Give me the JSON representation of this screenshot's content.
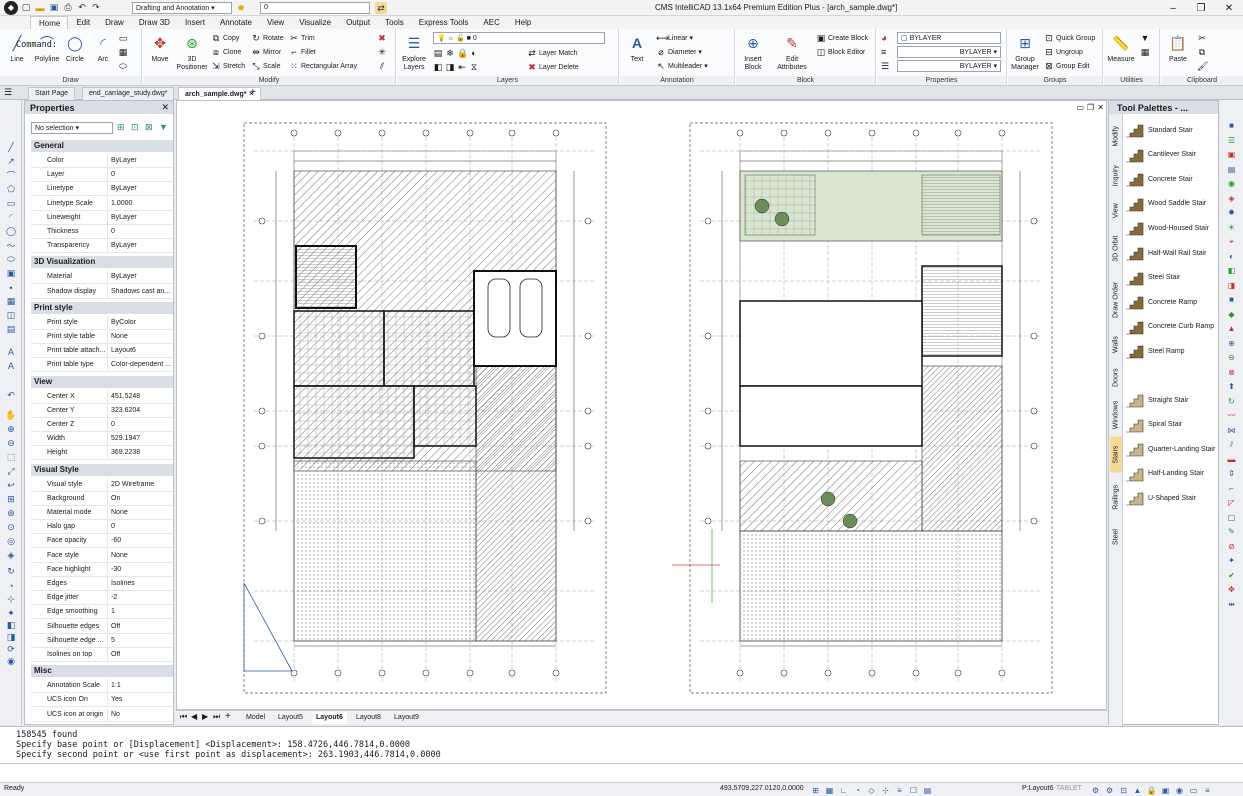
{
  "window": {
    "title": "CMS IntelliCAD 13.1x64 Premium Edition Plus - [arch_sample.dwg*]",
    "workspace": "Drafting and Annotation",
    "layer_combo": "0"
  },
  "menu": [
    "Home",
    "Edit",
    "Draw",
    "Draw 3D",
    "Insert",
    "Annotate",
    "View",
    "Visualize",
    "Output",
    "Tools",
    "Express Tools",
    "AEC",
    "Help"
  ],
  "ribbon": {
    "draw": {
      "label": "Draw",
      "line": "Line",
      "polyline": "Polyline",
      "circle": "Circle",
      "arc": "Arc"
    },
    "modify": {
      "label": "Modify",
      "move": "Move",
      "positioner": "3D Positioner",
      "copy": "Copy",
      "clone": "Clone",
      "stretch": "Stretch",
      "rotate": "Rotate",
      "mirror": "Mirror",
      "scale": "Scale",
      "trim": "Trim",
      "fillet": "Fillet",
      "rect_array": "Rectangular Array"
    },
    "layers": {
      "label": "Layers",
      "explore": "Explore Layers",
      "current": "0",
      "match": "Layer Match",
      "delete": "Layer Delete"
    },
    "annotation": {
      "label": "Annotation",
      "text": "Text",
      "linear": "Linear",
      "diameter": "Diameter",
      "multileader": "Multileader"
    },
    "block": {
      "label": "Block",
      "insert": "Insert Block",
      "edit_attr": "Edit Attributes",
      "create": "Create Block",
      "editor": "Block Editor"
    },
    "properties": {
      "label": "Properties",
      "layer": "BYLAYER",
      "linetype": "BYLAYER",
      "lineweight": "BYLAYER"
    },
    "groups": {
      "label": "Groups",
      "manager": "Group Manager",
      "quick": "Quick Group",
      "ungroup": "Ungroup",
      "edit": "Group Edit"
    },
    "utilities": {
      "label": "Utilities",
      "measure": "Measure"
    },
    "clipboard": {
      "label": "Clipboard",
      "paste": "Paste"
    }
  },
  "doc_tabs": [
    "Start Page",
    "end_carriage_study.dwg*",
    "arch_sample.dwg*"
  ],
  "properties_panel": {
    "title": "Properties",
    "selection": "No selection",
    "categories": [
      {
        "name": "General",
        "rows": [
          [
            "Color",
            "ByLayer"
          ],
          [
            "Layer",
            "0"
          ],
          [
            "Linetype",
            "ByLayer"
          ],
          [
            "Linetype Scale",
            "1.0000"
          ],
          [
            "Lineweight",
            "ByLayer"
          ],
          [
            "Thickness",
            "0"
          ],
          [
            "Transparency",
            "ByLayer"
          ]
        ]
      },
      {
        "name": "3D Visualization",
        "rows": [
          [
            "Material",
            "ByLayer"
          ],
          [
            "Shadow display",
            "Shadows cast an..."
          ]
        ]
      },
      {
        "name": "Print style",
        "rows": [
          [
            "Print style",
            "ByColor"
          ],
          [
            "Print style table",
            "None"
          ],
          [
            "Print table attach...",
            "Layout6"
          ],
          [
            "Print table type",
            "Color-dependent ..."
          ]
        ]
      },
      {
        "name": "View",
        "rows": [
          [
            "Center X",
            "451.5248"
          ],
          [
            "Center Y",
            "323.6204"
          ],
          [
            "Center Z",
            "0"
          ],
          [
            "Width",
            "529.1947"
          ],
          [
            "Height",
            "369.2238"
          ]
        ]
      },
      {
        "name": "Visual Style",
        "rows": [
          [
            "Visual style",
            "2D Wireframe"
          ],
          [
            "Background",
            "On"
          ],
          [
            "Material mode",
            "None"
          ],
          [
            "Halo gap",
            "0"
          ],
          [
            "Face opacity",
            "-60"
          ],
          [
            "Face style",
            "None"
          ],
          [
            "Face highlight",
            "-30"
          ],
          [
            "Edges",
            "Isolines"
          ],
          [
            "Edge jitter",
            "-2"
          ],
          [
            "Edge smoothing",
            "1"
          ],
          [
            "Silhouette edges",
            "Off"
          ],
          [
            "Silhouette edge ...",
            "5"
          ],
          [
            "Isolines on top",
            "Off"
          ]
        ]
      },
      {
        "name": "Misc",
        "rows": [
          [
            "Annotation Scale",
            "1:1"
          ],
          [
            "UCS icon On",
            "Yes"
          ],
          [
            "UCS icon at origin",
            "No"
          ]
        ]
      }
    ]
  },
  "sheet_tabs": [
    "Model",
    "Layout5",
    "Layout6",
    "Layout8",
    "Layout9"
  ],
  "active_sheet": "Layout6",
  "tool_palette": {
    "title": "Tool Palettes - ...",
    "tabs": [
      "Modify",
      "Inquiry",
      "View",
      "3D Orbit",
      "Draw Order",
      "Walls",
      "Doors",
      "Windows",
      "Stairs",
      "Railings",
      "Steel"
    ],
    "active_tab": "Stairs",
    "items_a": [
      "Standard Stair",
      "Cantilever Stair",
      "Concrete Stair",
      "Wood Saddle Stair",
      "Wood-Housed Stair",
      "Half-Wall Rail Stair",
      "Steel Stair",
      "Concrete Ramp",
      "Concrete Curb Ramp",
      "Steel Ramp"
    ],
    "items_b": [
      "Straight Stair",
      "Spiral Stair",
      "Quarter-Landing Stair",
      "Half-Landing Stair",
      "U-Shaped Stair"
    ]
  },
  "command": {
    "history": [
      "158545 found",
      "Specify base point or [Displacement] <Displacement>: 158.4726,446.7814,0.0000",
      "Specify second point or <use first point as displacement>: 263.1903,446.7814,0.0000"
    ],
    "prompt": "Command:"
  },
  "status": {
    "ready": "Ready",
    "coords": "493.5709,227.0120,0.0000",
    "layout": "P:Layout6",
    "tablet": "TABLET"
  }
}
